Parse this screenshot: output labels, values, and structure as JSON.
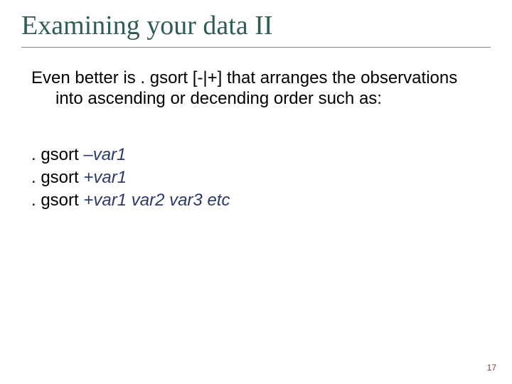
{
  "title": "Examining your data II",
  "paragraph": "Even better is . gsort [-|+] that arranges the observations into ascending or decending order such as:",
  "examples": {
    "line1_cmd": ". gsort ",
    "line1_arg": "–var1",
    "line2_cmd": ". gsort ",
    "line2_arg": "+var1",
    "line3_cmd": ". gsort ",
    "line3_arg": "+var1 var2 var3 etc"
  },
  "page_number": "17"
}
